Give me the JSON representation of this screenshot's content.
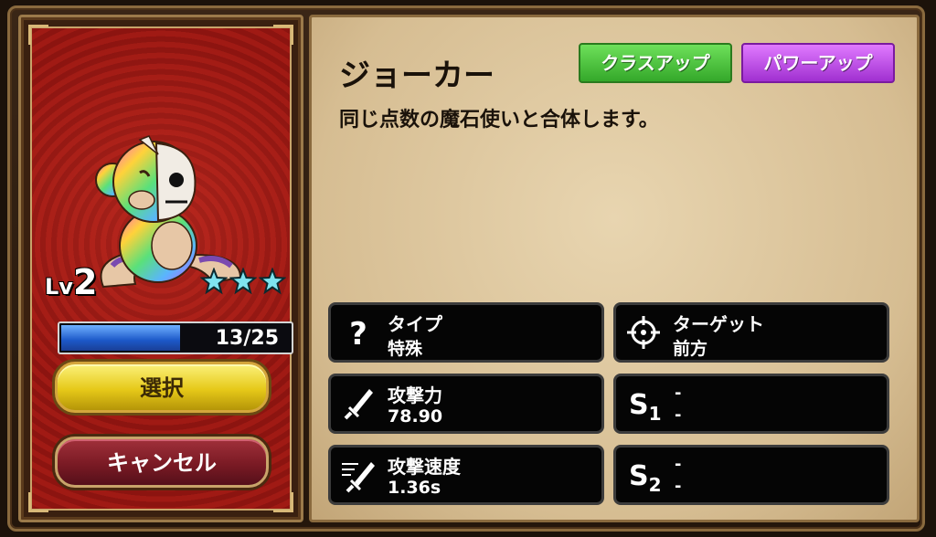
{
  "unit": {
    "name": "ジョーカー",
    "description": "同じ点数の魔石使いと合体します。",
    "level_label": "Lv",
    "level": "2",
    "stars": 3,
    "xp_text": "13/25",
    "xp_fraction": 0.52
  },
  "buttons": {
    "class_up": "クラスアップ",
    "power_up": "パワーアップ",
    "select": "選択",
    "cancel": "キャンセル"
  },
  "stats": {
    "type_label": "タイプ",
    "type_value": "特殊",
    "target_label": "ターゲット",
    "target_value": "前方",
    "attack_label": "攻撃力",
    "attack_value": "78.90",
    "speed_label": "攻撃速度",
    "speed_value": "1.36s",
    "s1_letter": "S",
    "s1_num": "1",
    "s1_line1": "-",
    "s1_line2": "-",
    "s2_letter": "S",
    "s2_num": "2",
    "s2_line1": "-",
    "s2_line2": "-"
  },
  "icons": {
    "type": "question-icon",
    "target": "crosshair-icon",
    "attack": "sword-icon",
    "speed": "swift-sword-icon",
    "star": "star-icon"
  },
  "colors": {
    "star": "#7fe3f0",
    "xp_fill": "#1c58c8",
    "class_up": "#34a82a",
    "power_up": "#a030d0",
    "select": "#e6c919",
    "cancel": "#7a1a24"
  }
}
